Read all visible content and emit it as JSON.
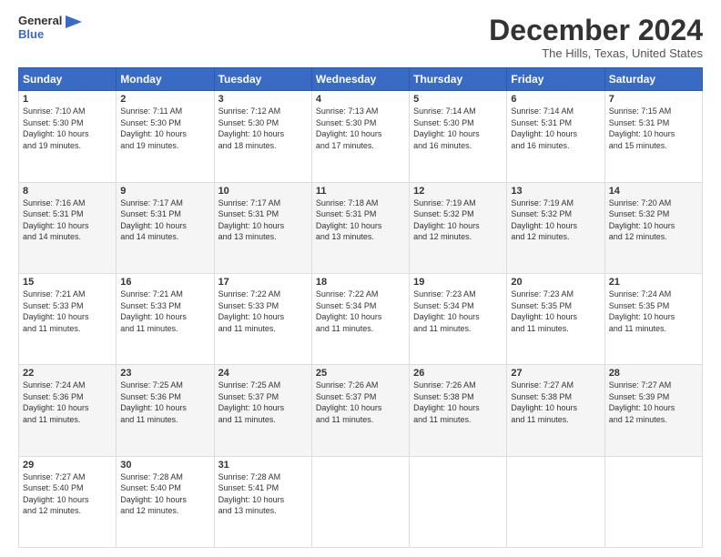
{
  "logo": {
    "line1": "General",
    "line2": "Blue"
  },
  "title": "December 2024",
  "subtitle": "The Hills, Texas, United States",
  "days_header": [
    "Sunday",
    "Monday",
    "Tuesday",
    "Wednesday",
    "Thursday",
    "Friday",
    "Saturday"
  ],
  "weeks": [
    [
      {
        "day": "1",
        "info": "Sunrise: 7:10 AM\nSunset: 5:30 PM\nDaylight: 10 hours\nand 19 minutes."
      },
      {
        "day": "2",
        "info": "Sunrise: 7:11 AM\nSunset: 5:30 PM\nDaylight: 10 hours\nand 19 minutes."
      },
      {
        "day": "3",
        "info": "Sunrise: 7:12 AM\nSunset: 5:30 PM\nDaylight: 10 hours\nand 18 minutes."
      },
      {
        "day": "4",
        "info": "Sunrise: 7:13 AM\nSunset: 5:30 PM\nDaylight: 10 hours\nand 17 minutes."
      },
      {
        "day": "5",
        "info": "Sunrise: 7:14 AM\nSunset: 5:30 PM\nDaylight: 10 hours\nand 16 minutes."
      },
      {
        "day": "6",
        "info": "Sunrise: 7:14 AM\nSunset: 5:31 PM\nDaylight: 10 hours\nand 16 minutes."
      },
      {
        "day": "7",
        "info": "Sunrise: 7:15 AM\nSunset: 5:31 PM\nDaylight: 10 hours\nand 15 minutes."
      }
    ],
    [
      {
        "day": "8",
        "info": "Sunrise: 7:16 AM\nSunset: 5:31 PM\nDaylight: 10 hours\nand 14 minutes."
      },
      {
        "day": "9",
        "info": "Sunrise: 7:17 AM\nSunset: 5:31 PM\nDaylight: 10 hours\nand 14 minutes."
      },
      {
        "day": "10",
        "info": "Sunrise: 7:17 AM\nSunset: 5:31 PM\nDaylight: 10 hours\nand 13 minutes."
      },
      {
        "day": "11",
        "info": "Sunrise: 7:18 AM\nSunset: 5:31 PM\nDaylight: 10 hours\nand 13 minutes."
      },
      {
        "day": "12",
        "info": "Sunrise: 7:19 AM\nSunset: 5:32 PM\nDaylight: 10 hours\nand 12 minutes."
      },
      {
        "day": "13",
        "info": "Sunrise: 7:19 AM\nSunset: 5:32 PM\nDaylight: 10 hours\nand 12 minutes."
      },
      {
        "day": "14",
        "info": "Sunrise: 7:20 AM\nSunset: 5:32 PM\nDaylight: 10 hours\nand 12 minutes."
      }
    ],
    [
      {
        "day": "15",
        "info": "Sunrise: 7:21 AM\nSunset: 5:33 PM\nDaylight: 10 hours\nand 11 minutes."
      },
      {
        "day": "16",
        "info": "Sunrise: 7:21 AM\nSunset: 5:33 PM\nDaylight: 10 hours\nand 11 minutes."
      },
      {
        "day": "17",
        "info": "Sunrise: 7:22 AM\nSunset: 5:33 PM\nDaylight: 10 hours\nand 11 minutes."
      },
      {
        "day": "18",
        "info": "Sunrise: 7:22 AM\nSunset: 5:34 PM\nDaylight: 10 hours\nand 11 minutes."
      },
      {
        "day": "19",
        "info": "Sunrise: 7:23 AM\nSunset: 5:34 PM\nDaylight: 10 hours\nand 11 minutes."
      },
      {
        "day": "20",
        "info": "Sunrise: 7:23 AM\nSunset: 5:35 PM\nDaylight: 10 hours\nand 11 minutes."
      },
      {
        "day": "21",
        "info": "Sunrise: 7:24 AM\nSunset: 5:35 PM\nDaylight: 10 hours\nand 11 minutes."
      }
    ],
    [
      {
        "day": "22",
        "info": "Sunrise: 7:24 AM\nSunset: 5:36 PM\nDaylight: 10 hours\nand 11 minutes."
      },
      {
        "day": "23",
        "info": "Sunrise: 7:25 AM\nSunset: 5:36 PM\nDaylight: 10 hours\nand 11 minutes."
      },
      {
        "day": "24",
        "info": "Sunrise: 7:25 AM\nSunset: 5:37 PM\nDaylight: 10 hours\nand 11 minutes."
      },
      {
        "day": "25",
        "info": "Sunrise: 7:26 AM\nSunset: 5:37 PM\nDaylight: 10 hours\nand 11 minutes."
      },
      {
        "day": "26",
        "info": "Sunrise: 7:26 AM\nSunset: 5:38 PM\nDaylight: 10 hours\nand 11 minutes."
      },
      {
        "day": "27",
        "info": "Sunrise: 7:27 AM\nSunset: 5:38 PM\nDaylight: 10 hours\nand 11 minutes."
      },
      {
        "day": "28",
        "info": "Sunrise: 7:27 AM\nSunset: 5:39 PM\nDaylight: 10 hours\nand 12 minutes."
      }
    ],
    [
      {
        "day": "29",
        "info": "Sunrise: 7:27 AM\nSunset: 5:40 PM\nDaylight: 10 hours\nand 12 minutes."
      },
      {
        "day": "30",
        "info": "Sunrise: 7:28 AM\nSunset: 5:40 PM\nDaylight: 10 hours\nand 12 minutes."
      },
      {
        "day": "31",
        "info": "Sunrise: 7:28 AM\nSunset: 5:41 PM\nDaylight: 10 hours\nand 13 minutes."
      },
      {
        "day": "",
        "info": ""
      },
      {
        "day": "",
        "info": ""
      },
      {
        "day": "",
        "info": ""
      },
      {
        "day": "",
        "info": ""
      }
    ]
  ]
}
